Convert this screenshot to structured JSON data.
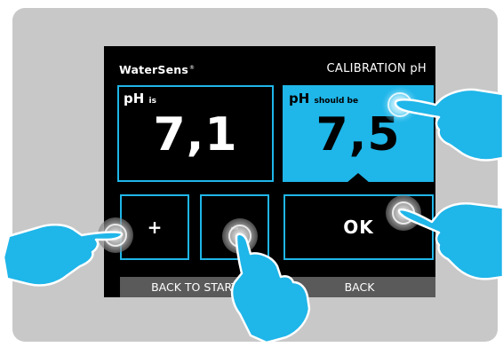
{
  "header": {
    "brand": "WaterSens",
    "brand_mark": "®",
    "title": "CALIBRATION pH"
  },
  "ph_is": {
    "label": "pH",
    "label_suffix": "is",
    "value": "7,1"
  },
  "ph_should_be": {
    "label": "pH",
    "label_suffix": "should be",
    "value": "7,5"
  },
  "keys": {
    "plus": "+",
    "minus": "–",
    "ok": "OK"
  },
  "footer": {
    "back_to_start": "BACK TO START",
    "back": "BACK"
  },
  "icons": [
    "hand-pointer-icon",
    "touch-ripple-icon"
  ],
  "colors": {
    "accent": "#1fb6e9",
    "screen": "#000000",
    "device": "#c8c8c8",
    "bottom_bar": "#5a5a5a"
  }
}
